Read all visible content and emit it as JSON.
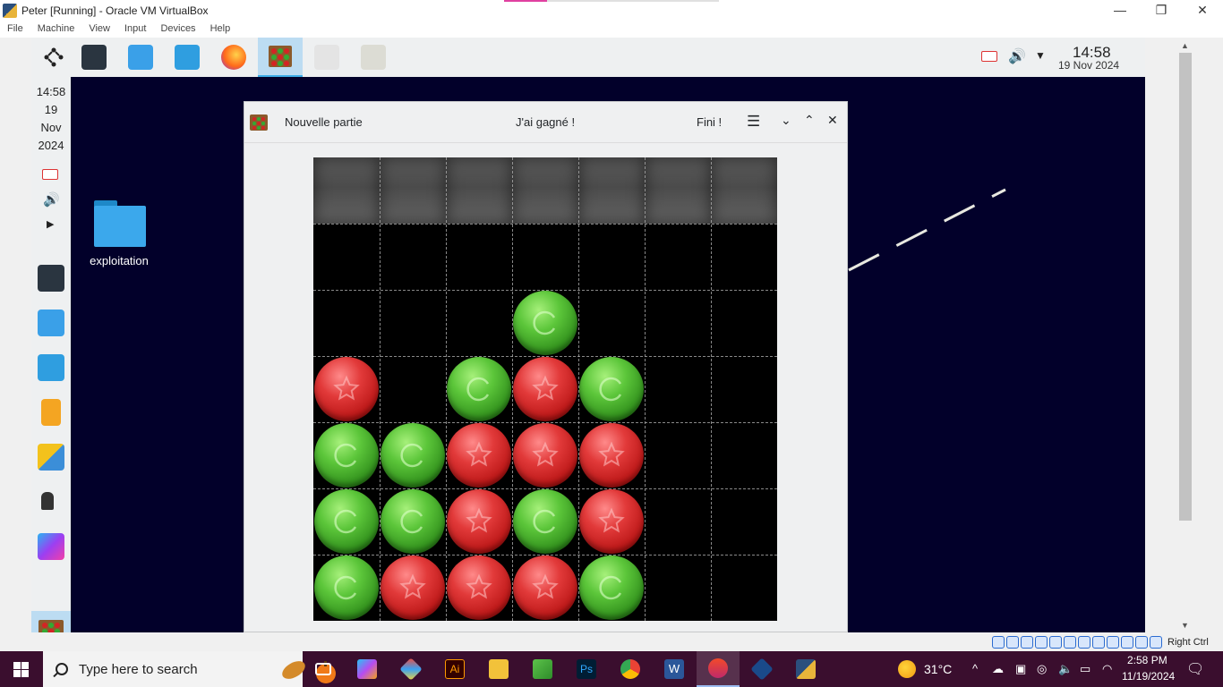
{
  "host": {
    "window_title": "Peter [Running] - Oracle VM VirtualBox",
    "window_buttons": {
      "minimize": "—",
      "restore": "❐",
      "close": "✕"
    },
    "menu": [
      "File",
      "Machine",
      "View",
      "Input",
      "Devices",
      "Help"
    ],
    "status_right_ctrl": "Right Ctrl"
  },
  "guest": {
    "clock": {
      "time": "14:58",
      "date": "19 Nov 2024"
    },
    "left_clock": {
      "time": "14:58",
      "day": "19",
      "month": "Nov",
      "year": "2024"
    },
    "desktop_folder": "exploitation"
  },
  "game": {
    "toolbar": {
      "new_game": "Nouvelle partie",
      "status": "J'ai gagné !",
      "finished": "Fini !",
      "menu_icon": "☰",
      "minimize_icon": "⌄",
      "maximize_icon": "⌃",
      "close_icon": "✕"
    },
    "board": {
      "columns": 7,
      "rows": 6,
      "grid": [
        [
          "",
          "",
          "",
          "",
          "",
          "",
          ""
        ],
        [
          "",
          "",
          "",
          "green",
          "",
          "",
          ""
        ],
        [
          "red",
          "",
          "green",
          "red",
          "green",
          "",
          ""
        ],
        [
          "green",
          "green",
          "red",
          "red",
          "red",
          "",
          ""
        ],
        [
          "green",
          "green",
          "red",
          "green",
          "red",
          "",
          ""
        ],
        [
          "green",
          "red",
          "red",
          "red",
          "green",
          "",
          ""
        ]
      ],
      "colors": {
        "green": "#4cb82c",
        "red": "#d42424"
      }
    }
  },
  "taskbar": {
    "search_placeholder": "Type here to search",
    "weather": "31°C",
    "time": "2:58 PM",
    "date": "11/19/2024",
    "apps": [
      "task-view",
      "copilot",
      "git",
      "illustrator",
      "file-explorer",
      "sheets",
      "photoshop",
      "chrome",
      "word",
      "app-red",
      "virtualbox",
      "vscode-like"
    ]
  }
}
